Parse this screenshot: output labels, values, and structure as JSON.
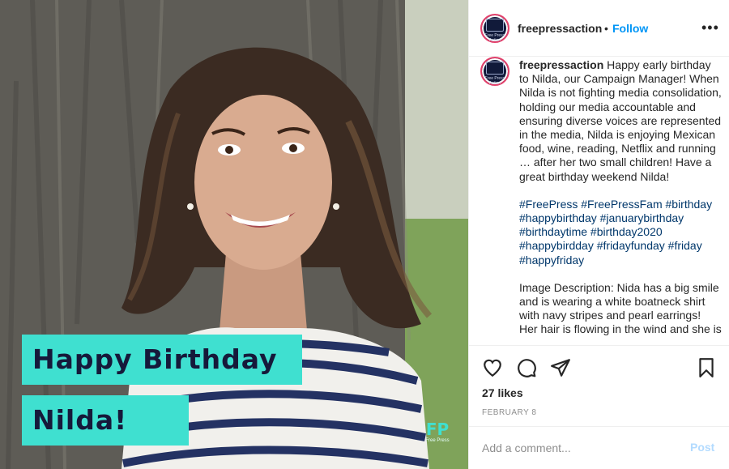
{
  "post": {
    "photo": {
      "banner_line1": "Happy Birthday",
      "banner_line2": "Nilda!",
      "logo_mark": "FP",
      "logo_name": "Free Press"
    },
    "header": {
      "username": "freepressaction",
      "separator": "•",
      "follow_label": "Follow",
      "more_icon": "more-options-icon"
    },
    "avatar": {
      "text": "Free Press Action"
    },
    "caption": {
      "username": "freepressaction",
      "text": "Happy early birthday to Nilda, our Campaign Manager! When Nilda is not fighting media consolidation, holding our media accountable and ensuring diverse voices are represented in the media, Nilda is enjoying Mexican food, wine, reading, Netflix and running … after her two small children! Have a great birthday weekend Nilda!",
      "hashtags": "#FreePress #FreePressFam #birthday #happybirthday #januarybirthday #birthdaytime #birthday2020 #happybirdday #fridayfunday #friday #happyfriday",
      "image_description": "Image Description: Nida has a big smile and is wearing a white boatneck shirt with navy stripes and pearl earrings! Her hair is flowing in the wind and she is"
    },
    "actions": {
      "icons": [
        "heart-icon",
        "comment-icon",
        "share-icon",
        "bookmark-icon"
      ],
      "likes": "27 likes",
      "date": "FEBRUARY 8"
    },
    "comment": {
      "placeholder": "Add a comment...",
      "post_label": "Post"
    }
  },
  "colors": {
    "banner": "#3fe0d0",
    "banner_text": "#16193a",
    "link_blue": "#0095f6",
    "hashtag_blue": "#00376b",
    "post_disabled": "#b3dbff",
    "avatar_bg": "#111a3a",
    "avatar_ring": "#e33f6a"
  }
}
